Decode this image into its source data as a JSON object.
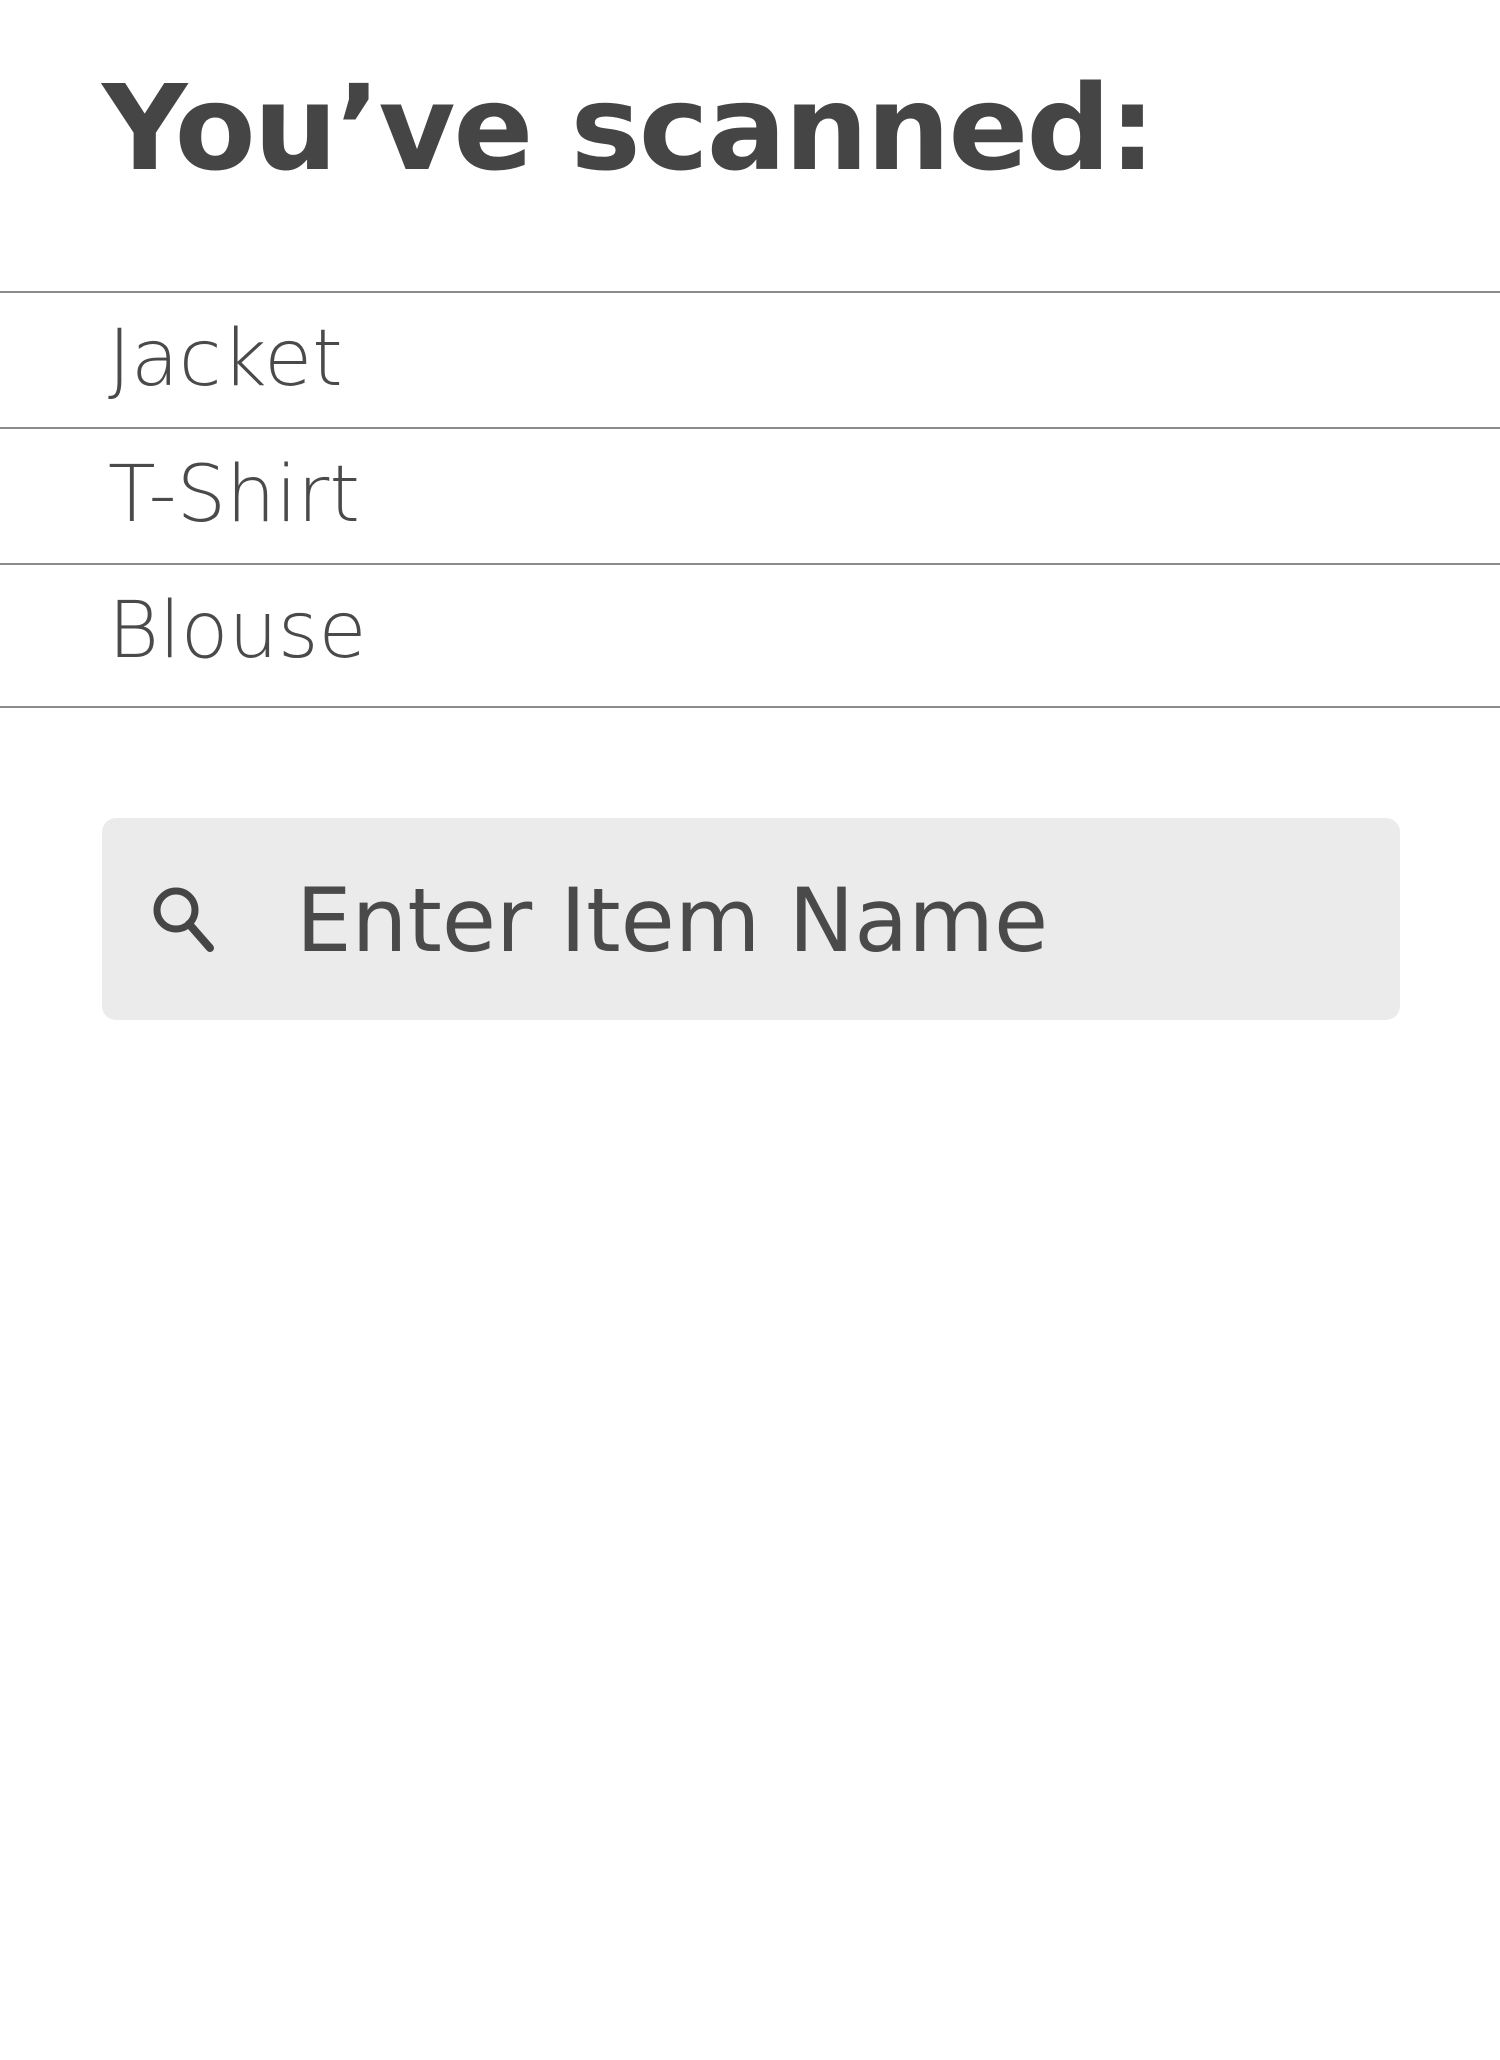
{
  "header": {
    "title": "You’ve scanned:"
  },
  "scanned_items": [
    {
      "label": "Jacket"
    },
    {
      "label": "T-Shirt"
    },
    {
      "label": "Blouse"
    }
  ],
  "search": {
    "placeholder": "Enter Item Name",
    "value": "",
    "icon": "search-icon"
  },
  "colors": {
    "text": "#454545",
    "divider": "#8c8c8c",
    "search_background": "#ebebeb",
    "page_background": "#ffffff"
  }
}
